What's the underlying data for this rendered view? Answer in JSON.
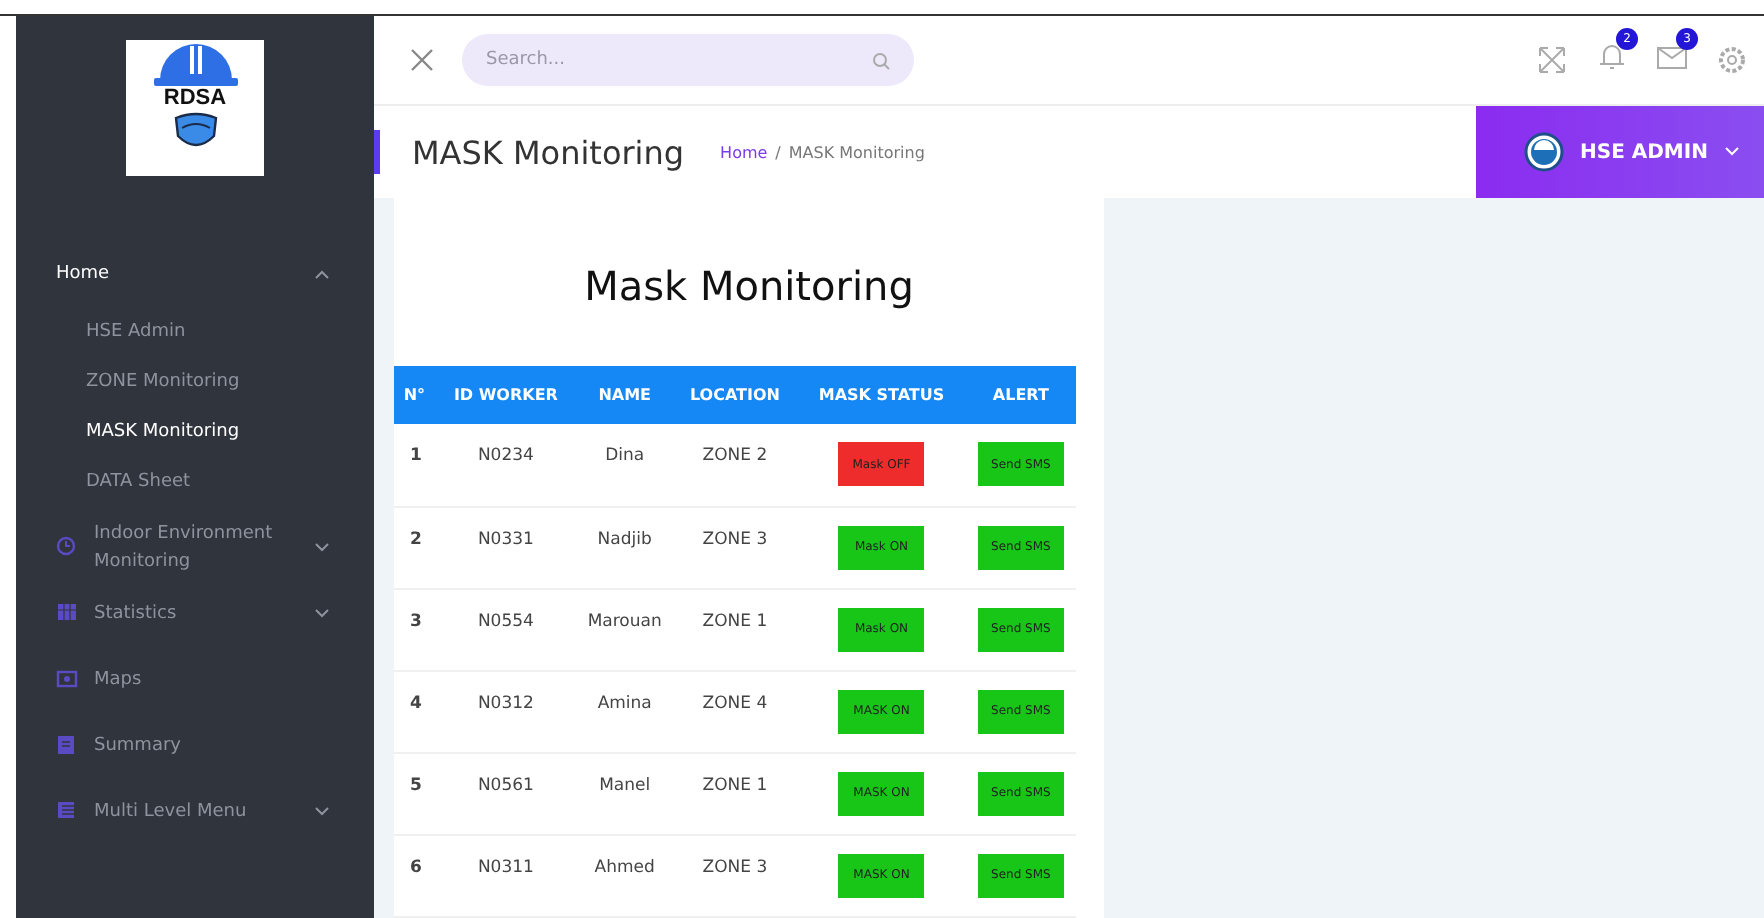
{
  "logo": {
    "text": "RDSA"
  },
  "sidebar": {
    "items": [
      {
        "kind": "group",
        "label": "Home",
        "expanded": true,
        "children": [
          {
            "label": "HSE Admin",
            "selected": false
          },
          {
            "label": "ZONE Monitoring",
            "selected": false
          },
          {
            "label": "MASK Monitoring",
            "selected": true
          },
          {
            "label": "DATA Sheet",
            "selected": false
          }
        ]
      },
      {
        "kind": "group",
        "label": "Indoor Environment Monitoring",
        "expanded": false
      },
      {
        "kind": "group",
        "label": "Statistics",
        "expanded": false
      },
      {
        "kind": "link",
        "label": "Maps"
      },
      {
        "kind": "link",
        "label": "Summary"
      },
      {
        "kind": "group",
        "label": "Multi Level Menu",
        "expanded": false
      }
    ]
  },
  "search": {
    "placeholder": "Search..."
  },
  "notifications": {
    "alerts": "2",
    "messages": "3"
  },
  "page": {
    "title": "MASK Monitoring",
    "breadcrumb": [
      "Home",
      "MASK Monitoring"
    ],
    "breadcrumb_separator": "/"
  },
  "user": {
    "name": "HSE ADMIN"
  },
  "card": {
    "title": "Mask Monitoring"
  },
  "table": {
    "columns": [
      "N°",
      "ID WORKER",
      "NAME",
      "LOCATION",
      "MASK STATUS",
      "ALERT"
    ],
    "rows": [
      {
        "n": "1",
        "id": "N0234",
        "name": "Dina",
        "location": "ZONE 2",
        "mask": {
          "text": "Mask OFF",
          "on": false
        },
        "alert": "Send SMS"
      },
      {
        "n": "2",
        "id": "N0331",
        "name": "Nadjib",
        "location": "ZONE 3",
        "mask": {
          "text": "Mask ON",
          "on": true
        },
        "alert": "Send SMS"
      },
      {
        "n": "3",
        "id": "N0554",
        "name": "Marouan",
        "location": "ZONE 1",
        "mask": {
          "text": "Mask ON",
          "on": true
        },
        "alert": "Send SMS"
      },
      {
        "n": "4",
        "id": "N0312",
        "name": "Amina",
        "location": "ZONE 4",
        "mask": {
          "text": "MASK ON",
          "on": true
        },
        "alert": "Send SMS"
      },
      {
        "n": "5",
        "id": "N0561",
        "name": "Manel",
        "location": "ZONE 1",
        "mask": {
          "text": "MASK ON",
          "on": true
        },
        "alert": "Send SMS"
      },
      {
        "n": "6",
        "id": "N0311",
        "name": "Ahmed",
        "location": "ZONE 3",
        "mask": {
          "text": "MASK ON",
          "on": true
        },
        "alert": "Send SMS"
      }
    ]
  }
}
